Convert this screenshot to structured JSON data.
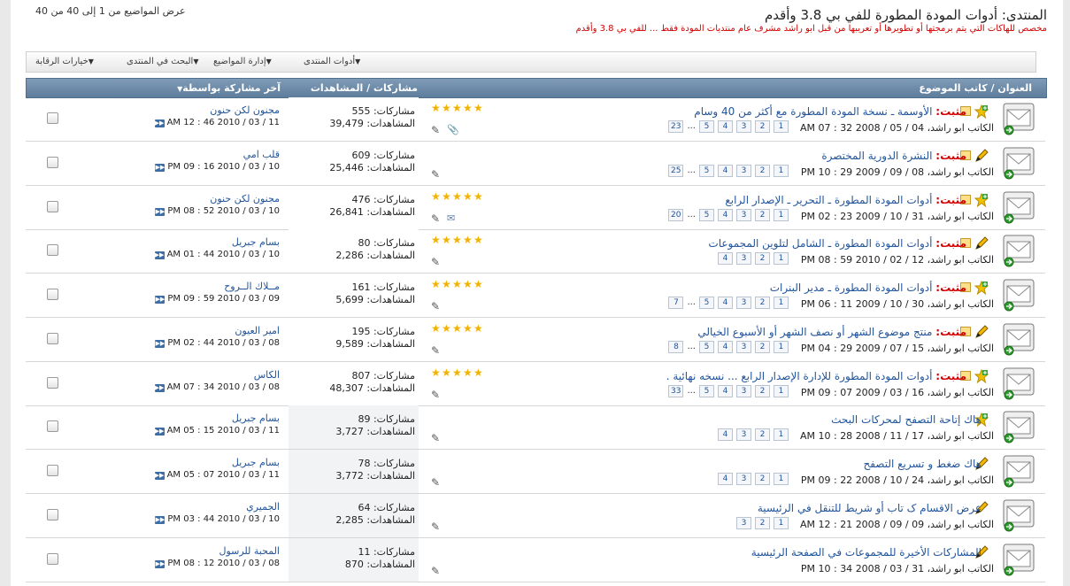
{
  "header": {
    "forum_title": "المنتدى: أدوات المودة المطورة للفي بي 3.8 وأقدم",
    "forum_description": "مخصص للهاكات التي يتم برمجتها أو تطويرها أو تعريبها من قبل ابو راشد مشرف عام منتديات المودة فقط ... للفي بي 3.8 وأقدم",
    "showing": "عرض المواضيع من 1 إلى 40 من 40"
  },
  "toolbar": {
    "forum_tools": "أدوات المنتدى",
    "thread_management": "إدارة المواضيع",
    "search_forum": "البحث في المنتدى",
    "moderation_options": "خيارات الرقابة"
  },
  "table_header": {
    "title_author": "العنوان / كاتب الموضوع",
    "posts_views": "مشاركات / المشاهدات",
    "last_post": "آخر مشاركة بواسطة"
  },
  "labels": {
    "posts": "مشاركات:",
    "views": "المشاهدات:",
    "author_prefix": "الكاتب",
    "sticky": "مثبت:"
  },
  "threads": [
    {
      "sticky": true,
      "title": "الأوسمة ـ نسخة المودة المطورة مع أكثر من 40 وسام",
      "author": "ابو راشد",
      "date": "04 / 05 / 2008 32 : 07 AM",
      "pages": [
        "1",
        "2",
        "3",
        "4",
        "5",
        "...",
        "23"
      ],
      "posts": "555",
      "views": "39,479",
      "rating": 5,
      "attachment": true,
      "last_user": "مجنون لكن حنون",
      "last_date": "11 / 03 / 2010 46 : 12 AM",
      "icon": "star-plus"
    },
    {
      "sticky": true,
      "title": "النشرة الدورية المختصرة",
      "author": "ابو راشد",
      "date": "08 / 09 / 2009 29 : 10 PM",
      "pages": [
        "1",
        "2",
        "3",
        "4",
        "5",
        "...",
        "25"
      ],
      "posts": "609",
      "views": "25,446",
      "rating": 0,
      "attachment": false,
      "last_user": "قلب امي",
      "last_date": "10 / 03 / 2010 16 : 09 PM",
      "icon": "pencil"
    },
    {
      "sticky": true,
      "title": "أدوات المودة المطورة ـ التحرير ـ الإصدار الرابع",
      "author": "ابو راشد",
      "date": "31 / 10 / 2009 23 : 02 PM",
      "pages": [
        "1",
        "2",
        "3",
        "4",
        "5",
        "...",
        "20"
      ],
      "posts": "476",
      "views": "26,841",
      "rating": 5,
      "attachment": false,
      "mail": true,
      "last_user": "مجنون لكن حنون",
      "last_date": "10 / 03 / 2010 52 : 08 PM",
      "icon": "star-plus"
    },
    {
      "sticky": true,
      "title": "أدوات المودة المطورة ـ الشامل لتلوين المجموعات",
      "author": "ابو راشد",
      "date": "12 / 02 / 2010 59 : 08 PM",
      "pages": [
        "1",
        "2",
        "3",
        "4"
      ],
      "posts": "80",
      "views": "2,286",
      "rating": 5,
      "attachment": false,
      "last_user": "بسام جبريل",
      "last_date": "10 / 03 / 2010 44 : 01 AM",
      "icon": "pencil"
    },
    {
      "sticky": true,
      "title": "أدوات المودة المطورة ـ مدير البنرات",
      "author": "ابو راشد",
      "date": "30 / 10 / 2009 11 : 06 PM",
      "pages": [
        "1",
        "2",
        "3",
        "4",
        "5",
        "...",
        "7"
      ],
      "posts": "161",
      "views": "5,699",
      "rating": 5,
      "attachment": false,
      "last_user": "مــلاك الــروح",
      "last_date": "09 / 03 / 2010 59 : 09 PM",
      "icon": "star-plus"
    },
    {
      "sticky": true,
      "title": "منتج موضوع الشهر أو نصف الشهر أو الأسبوع الخيالي",
      "author": "ابو راشد",
      "date": "15 / 07 / 2009 29 : 04 PM",
      "pages": [
        "1",
        "2",
        "3",
        "4",
        "5",
        "...",
        "8"
      ],
      "posts": "195",
      "views": "9,589",
      "rating": 5,
      "attachment": false,
      "last_user": "امير العيون",
      "last_date": "08 / 03 / 2010 44 : 02 PM",
      "icon": "pencil"
    },
    {
      "sticky": true,
      "title": "أدوات المودة المطورة للإدارة الإصدار الرابع ... نسخه نهائية .",
      "author": "ابو راشد",
      "date": "16 / 03 / 2009 07 : 09 PM",
      "pages": [
        "1",
        "2",
        "3",
        "4",
        "5",
        "...",
        "33"
      ],
      "posts": "807",
      "views": "48,307",
      "rating": 5,
      "attachment": false,
      "last_user": "الكاس",
      "last_date": "08 / 03 / 2010 34 : 07 AM",
      "icon": "star-plus"
    },
    {
      "sticky": false,
      "title": "هاك إتاحة التصفح لمحركات البحث",
      "author": "ابو راشد",
      "date": "17 / 11 / 2008 28 : 10 AM",
      "pages": [
        "1",
        "2",
        "3",
        "4"
      ],
      "posts": "89",
      "views": "3,727",
      "rating": 0,
      "attachment": false,
      "last_user": "بسام جبريل",
      "last_date": "11 / 03 / 2010 15 : 05 AM",
      "icon": "star-plus"
    },
    {
      "sticky": false,
      "title": "هاك ضغط و تسريع التصفح",
      "author": "ابو راشد",
      "date": "24 / 10 / 2008 22 : 09 PM",
      "pages": [
        "1",
        "2",
        "3",
        "4"
      ],
      "posts": "78",
      "views": "3,772",
      "rating": 0,
      "attachment": false,
      "last_user": "بسام جبريل",
      "last_date": "11 / 03 / 2010 07 : 05 AM",
      "icon": "pencil"
    },
    {
      "sticky": false,
      "title": "عرض الاقسام ک تاب أو شريط للتنقل في الرئيسية",
      "author": "ابو راشد",
      "date": "09 / 09 / 2008 21 : 12 AM",
      "pages": [
        "1",
        "2",
        "3"
      ],
      "posts": "64",
      "views": "2,285",
      "rating": 0,
      "attachment": false,
      "last_user": "الجميري",
      "last_date": "10 / 03 / 2010 44 : 03 PM",
      "icon": "pencil"
    },
    {
      "sticky": false,
      "title": "المشاركات الأخيرة للمجموعات في الصفحة الرئيسية",
      "author": "ابو راشد",
      "date": "31 / 03 / 2008 34 : 10 PM",
      "pages": [],
      "posts": "11",
      "views": "870",
      "rating": 0,
      "attachment": false,
      "last_user": "المحبة للرسول",
      "last_date": "08 / 03 / 2010 12 : 08 PM",
      "icon": "pencil"
    }
  ]
}
